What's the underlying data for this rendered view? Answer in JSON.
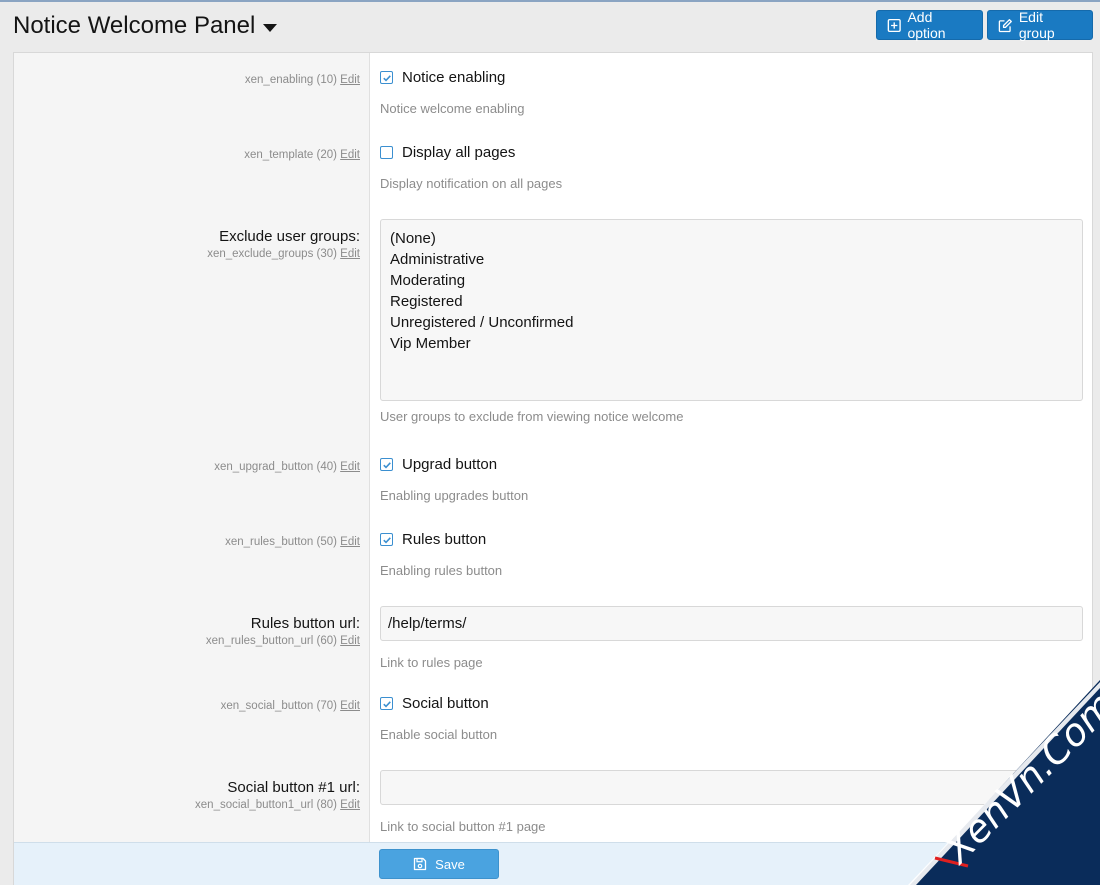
{
  "header": {
    "title": "Notice Welcome Panel",
    "add_option_label": "Add option",
    "edit_group_label": "Edit group"
  },
  "options": {
    "enabling": {
      "label": "Notice enabling",
      "meta_id": "xen_enabling (10)",
      "edit": "Edit",
      "hint": "Notice welcome enabling",
      "checked": true
    },
    "template": {
      "label": "Display all pages",
      "meta_id": "xen_template (20)",
      "edit": "Edit",
      "hint": "Display notification on all pages",
      "checked": false
    },
    "exclude_groups": {
      "label": "Exclude user groups:",
      "meta_id": "xen_exclude_groups (30)",
      "edit": "Edit",
      "items": [
        "(None)",
        "Administrative",
        "Moderating",
        "Registered",
        "Unregistered / Unconfirmed",
        "Vip Member"
      ],
      "hint": "User groups to exclude from viewing notice welcome"
    },
    "upgrad_button": {
      "label": "Upgrad button",
      "meta_id": "xen_upgrad_button (40)",
      "edit": "Edit",
      "hint": "Enabling upgrades button",
      "checked": true
    },
    "rules_button": {
      "label": "Rules button",
      "meta_id": "xen_rules_button (50)",
      "edit": "Edit",
      "hint": "Enabling rules button",
      "checked": true
    },
    "rules_button_url": {
      "label": "Rules button url:",
      "meta_id": "xen_rules_button_url (60)",
      "edit": "Edit",
      "value": "/help/terms/",
      "hint": "Link to rules page"
    },
    "social_button": {
      "label": "Social button",
      "meta_id": "xen_social_button (70)",
      "edit": "Edit",
      "hint": "Enable social button",
      "checked": true
    },
    "social_button1_url": {
      "label": "Social button #1 url:",
      "meta_id": "xen_social_button1_url (80)",
      "edit": "Edit",
      "value": "",
      "hint": "Link to social button #1 page"
    }
  },
  "footer": {
    "save_label": "Save"
  },
  "watermark": {
    "text": "XenVn.Com"
  },
  "colors": {
    "primary": "#1a7ac2",
    "save": "#4aa3e0",
    "footer_bg": "#e6f1fa",
    "watermark": "#0a2c5a"
  }
}
